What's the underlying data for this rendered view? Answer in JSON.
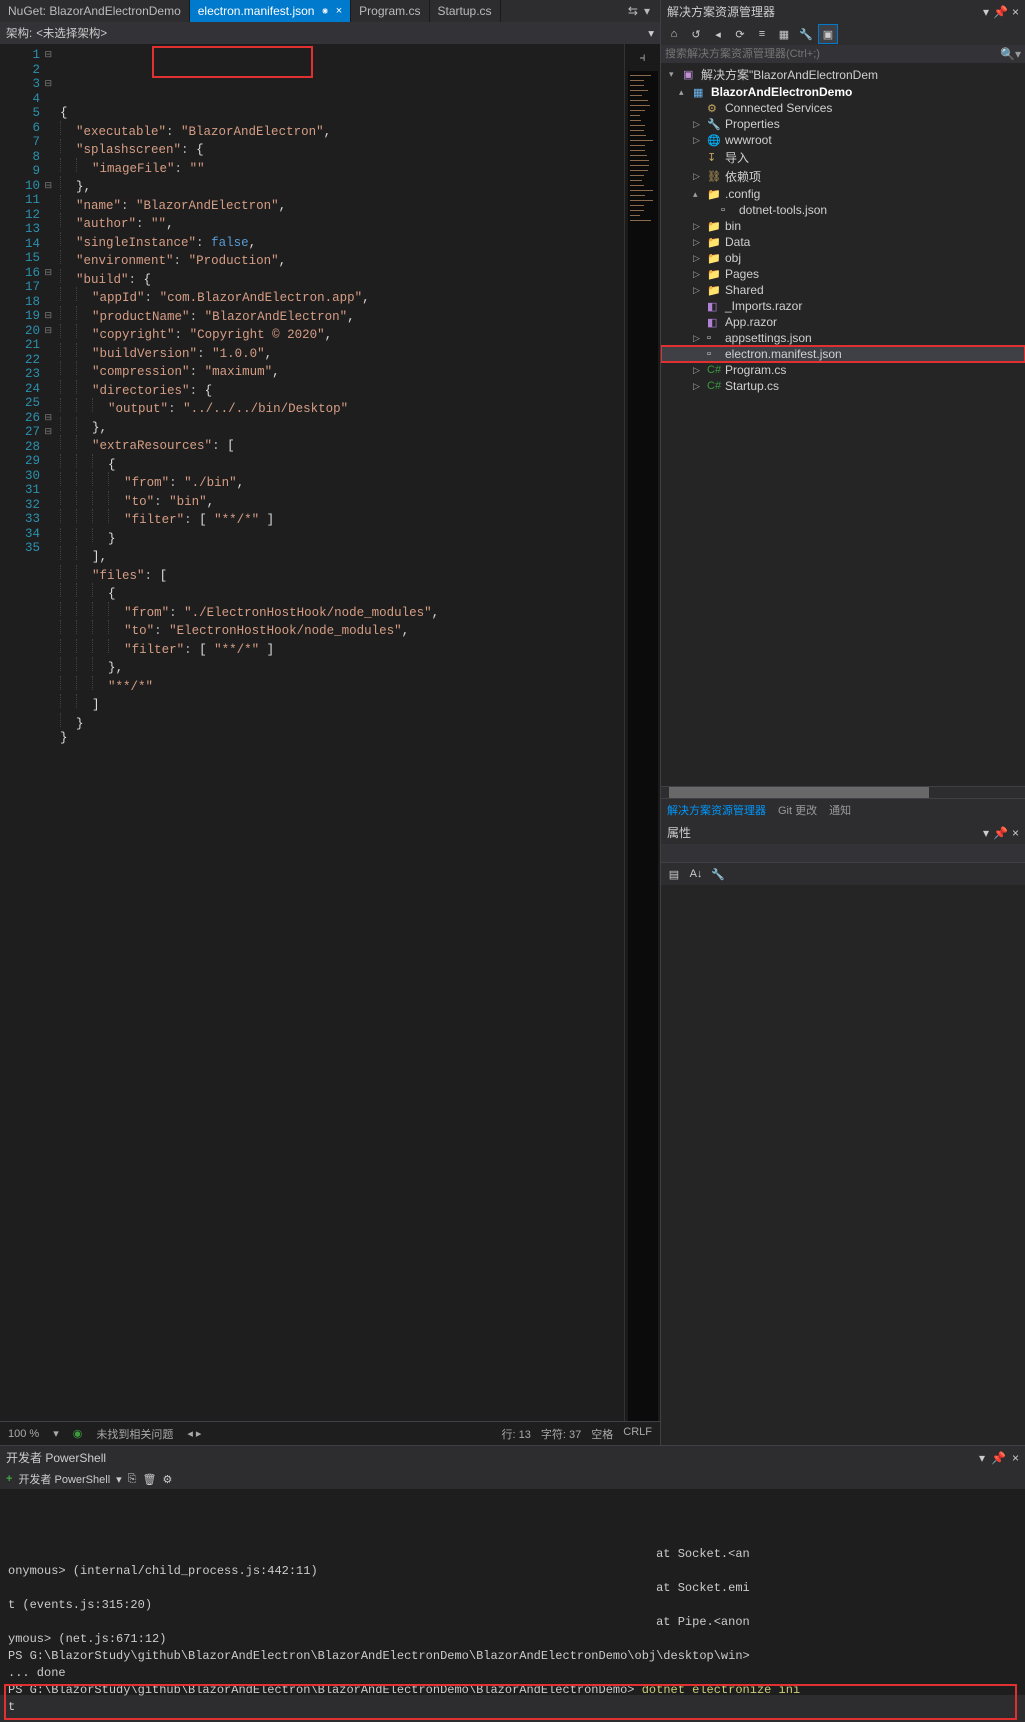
{
  "tabs": [
    {
      "label": "NuGet: BlazorAndElectronDemo"
    },
    {
      "label": "electron.manifest.json",
      "active": true
    },
    {
      "label": "Program.cs"
    },
    {
      "label": "Startup.cs"
    }
  ],
  "arch": {
    "label": "架构:",
    "value": "<未选择架构>"
  },
  "code_lines": 35,
  "status": {
    "zoom": "100 %",
    "issues": "未找到相关问题",
    "line": "行: 13",
    "col": "字符: 37",
    "ws": "空格",
    "crlf": "CRLF"
  },
  "solution_explorer": {
    "title": "解决方案资源管理器",
    "search_placeholder": "搜索解决方案资源管理器(Ctrl+;)",
    "root": "解决方案\"BlazorAndElectronDem",
    "project": "BlazorAndElectronDemo",
    "items": [
      {
        "label": "Connected Services",
        "exp": "",
        "ico": "⚙"
      },
      {
        "label": "Properties",
        "exp": "▷",
        "ico": "🔧"
      },
      {
        "label": "wwwroot",
        "exp": "▷",
        "ico": "🌐"
      },
      {
        "label": "导入",
        "exp": "",
        "ico": "↧"
      },
      {
        "label": "依赖项",
        "exp": "▷",
        "ico": "⛓"
      }
    ],
    "config": {
      "label": ".config",
      "child": "dotnet-tools.json"
    },
    "folders": [
      "bin",
      "Data",
      "obj",
      "Pages",
      "Shared"
    ],
    "files": [
      "_Imports.razor",
      "App.razor"
    ],
    "json_files": [
      "appsettings.json",
      "electron.manifest.json"
    ],
    "cs_files": [
      "Program.cs",
      "Startup.cs"
    ]
  },
  "side_tabs": [
    "解决方案资源管理器",
    "Git 更改",
    "通知"
  ],
  "props": {
    "title": "属性"
  },
  "terminal": {
    "title": "开发者 PowerShell",
    "tab": "开发者 PowerShell",
    "lines": [
      "                                                                                          at Socket.<an",
      "onymous> (internal/child_process.js:442:11)",
      "                                                                                          at Socket.emi",
      "t (events.js:315:20)",
      "                                                                                          at Pipe.<anon",
      "ymous> (net.js:671:12)",
      "PS G:\\BlazorStudy\\github\\BlazorAndElectron\\BlazorAndElectronDemo\\BlazorAndElectronDemo\\obj\\desktop\\win>",
      "... done"
    ],
    "prompt": "PS G:\\BlazorStudy\\github\\BlazorAndElectron\\BlazorAndElectronDemo\\BlazorAndElectronDemo>",
    "cmd": "dotnet electronize ini",
    "prompt_tail": "t"
  },
  "json_tokens": {
    "l1": [
      "{"
    ],
    "l2": [
      "  ",
      "\"executable\"",
      ": ",
      "\"BlazorAndElectron\"",
      ","
    ],
    "l3": [
      "  ",
      "\"splashscreen\"",
      ": ",
      "{"
    ],
    "l4": [
      "    ",
      "\"imageFile\"",
      ": ",
      "\"\""
    ],
    "l5": [
      "  ",
      "}",
      ","
    ],
    "l6": [
      "  ",
      "\"name\"",
      ": ",
      "\"BlazorAndElectron\"",
      ","
    ],
    "l7": [
      "  ",
      "\"author\"",
      ": ",
      "\"\"",
      ","
    ],
    "l8": [
      "  ",
      "\"singleInstance\"",
      ": ",
      "false",
      ","
    ],
    "l9": [
      "  ",
      "\"environment\"",
      ": ",
      "\"Production\"",
      ","
    ],
    "l10": [
      "  ",
      "\"build\"",
      ": ",
      "{"
    ],
    "l11": [
      "    ",
      "\"appId\"",
      ": ",
      "\"com.BlazorAndElectron.app\"",
      ","
    ],
    "l12": [
      "    ",
      "\"productName\"",
      ": ",
      "\"BlazorAndElectron\"",
      ","
    ],
    "l13": [
      "    ",
      "\"copyright\"",
      ": ",
      "\"Copyright © 2020\"",
      ","
    ],
    "l14": [
      "    ",
      "\"buildVersion\"",
      ": ",
      "\"1.0.0\"",
      ","
    ],
    "l15": [
      "    ",
      "\"compression\"",
      ": ",
      "\"maximum\"",
      ","
    ],
    "l16": [
      "    ",
      "\"directories\"",
      ": ",
      "{"
    ],
    "l17": [
      "      ",
      "\"output\"",
      ": ",
      "\"../../../bin/Desktop\""
    ],
    "l18": [
      "    ",
      "}",
      ","
    ],
    "l19": [
      "    ",
      "\"extraResources\"",
      ": ",
      "["
    ],
    "l20": [
      "      ",
      "{"
    ],
    "l21": [
      "        ",
      "\"from\"",
      ": ",
      "\"./bin\"",
      ","
    ],
    "l22": [
      "        ",
      "\"to\"",
      ": ",
      "\"bin\"",
      ","
    ],
    "l23": [
      "        ",
      "\"filter\"",
      ": ",
      "[ ",
      "\"**/*\"",
      " ]"
    ],
    "l24": [
      "      ",
      "}"
    ],
    "l25": [
      "    ",
      "]",
      ","
    ],
    "l26": [
      "    ",
      "\"files\"",
      ": ",
      "["
    ],
    "l27": [
      "      ",
      "{"
    ],
    "l28": [
      "        ",
      "\"from\"",
      ": ",
      "\"./ElectronHostHook/node_modules\"",
      ","
    ],
    "l29": [
      "        ",
      "\"to\"",
      ": ",
      "\"ElectronHostHook/node_modules\"",
      ","
    ],
    "l30": [
      "        ",
      "\"filter\"",
      ": ",
      "[ ",
      "\"**/*\"",
      " ]"
    ],
    "l31": [
      "      ",
      "}",
      ","
    ],
    "l32": [
      "      ",
      "\"**/*\""
    ],
    "l33": [
      "    ",
      "]"
    ],
    "l34": [
      "  ",
      "}"
    ],
    "l35": [
      "}"
    ]
  }
}
